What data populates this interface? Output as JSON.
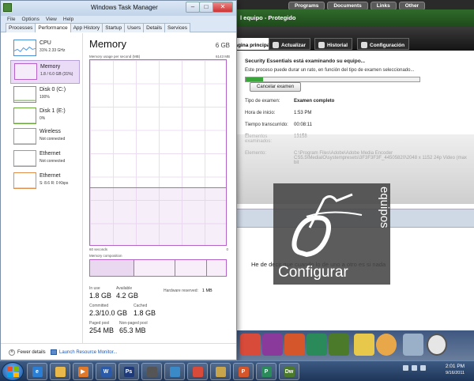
{
  "background": {
    "top_links": [
      "Programs",
      "Documents",
      "Links",
      "Other"
    ],
    "mse": {
      "title": "l equipo - Protegido",
      "tabs": [
        "Página principal",
        "Actualizar",
        "Historial",
        "Configuración"
      ],
      "heading": "Security Essentials está examinando su equipo...",
      "subtext": "Este proceso puede durar un rato, en función del tipo de examen seleccionado...",
      "progress": 0.1,
      "cancel_label": "Cancelar examen",
      "details": [
        {
          "key": "Tipo de examen:",
          "value": "Examen completo"
        },
        {
          "key": "Hora de inicio:",
          "value": "1:53 PM"
        },
        {
          "key": "Tiempo transcurrido:",
          "value": "00:08:11"
        },
        {
          "key": "Elementos examinados:",
          "value": "13158"
        },
        {
          "key": "Elemento:",
          "value": "C:\\Program Files\\Adobe\\Adobe Media Encoder CS5.5\\MediaIO\\systempresets\\3F3F3F3F_44505820\\2048 x 1152 24p Video (max bit"
        }
      ]
    },
    "doc_text": "He de decir que cuando lo de uno a otro es si nada",
    "configurar": {
      "label": "Configurar",
      "vertical": "equipos"
    }
  },
  "taskmanager": {
    "title": "Windows Task Manager",
    "menu": [
      "File",
      "Options",
      "View",
      "Help"
    ],
    "tabs": [
      "Processes",
      "Performance",
      "App History",
      "Startup",
      "Users",
      "Details",
      "Services"
    ],
    "active_tab": "Performance",
    "controls": {
      "minimize": "–",
      "maximize": "□",
      "close": "✕"
    },
    "resources": [
      {
        "name": "CPU",
        "detail": "31%  2.33 GHz",
        "color": "#4a90d9",
        "selected": false
      },
      {
        "name": "Memory",
        "detail": "1.8 / 6.0 GB (31%)",
        "color": "#b464c8",
        "selected": true
      },
      {
        "name": "Disk 0 (C:)",
        "detail": "100%",
        "color": "#6aaa3a",
        "selected": false
      },
      {
        "name": "Disk 1 (E:)",
        "detail": "0%",
        "color": "#6aaa3a",
        "selected": false
      },
      {
        "name": "Wireless",
        "detail": "Not connected",
        "color": "#999999",
        "selected": false
      },
      {
        "name": "Ethernet",
        "detail": "Not connected",
        "color": "#999999",
        "selected": false
      },
      {
        "name": "Ethernet",
        "detail": "S: 8.6  R: 0 Kbps",
        "color": "#e0904a",
        "selected": false
      }
    ],
    "memory": {
      "title": "Memory",
      "total": "6 GB",
      "usage_label": "Memory usage per second (MB)",
      "usage_max": "6143 MB",
      "usage_fraction": 0.31,
      "time_left": "60 seconds",
      "time_right": "0",
      "composition_label": "Memory composition",
      "stats": {
        "in_use_label": "In use",
        "in_use": "1.8 GB",
        "available_label": "Available",
        "available": "4.2 GB",
        "hw_reserved_label": "Hardware reserved:",
        "hw_reserved": "1 MB",
        "committed_label": "Committed",
        "committed": "2.3/10.0 GB",
        "cached_label": "Cached",
        "cached": "1.8 GB",
        "paged_label": "Paged pool",
        "paged": "254 MB",
        "nonpaged_label": "Non-paged pool",
        "nonpaged": "65.3 MB"
      }
    },
    "footer": {
      "fewer": "Fewer details",
      "launch": "Launch Resource Monitor..."
    }
  },
  "taskbar": {
    "time": "2:01 PM",
    "date": "9/16/2011",
    "pinned": [
      {
        "icon": "ie-icon",
        "glyph": "e",
        "color": "#2a7fd4"
      },
      {
        "icon": "folder-icon",
        "glyph": "",
        "color": "#e8b84a"
      },
      {
        "icon": "media-icon",
        "glyph": "▶",
        "color": "#e07a2a"
      },
      {
        "icon": "word-icon",
        "glyph": "W",
        "color": "#2a5aa8"
      },
      {
        "icon": "photoshop-icon",
        "glyph": "Ps",
        "color": "#1e3a7a"
      },
      {
        "icon": "flash-icon",
        "glyph": "",
        "color": "#555555"
      },
      {
        "icon": "photo-icon",
        "glyph": "",
        "color": "#3a8ac8"
      },
      {
        "icon": "chrome-icon",
        "glyph": "",
        "color": "#d84a3a"
      },
      {
        "icon": "explorer-icon",
        "glyph": "",
        "color": "#c8a44a"
      },
      {
        "icon": "powerpoint-icon",
        "glyph": "P",
        "color": "#d4562a"
      },
      {
        "icon": "publisher-icon",
        "glyph": "P",
        "color": "#2a8a5a"
      },
      {
        "icon": "dreamweaver-icon",
        "glyph": "Dw",
        "color": "#4a7a2a"
      }
    ]
  }
}
